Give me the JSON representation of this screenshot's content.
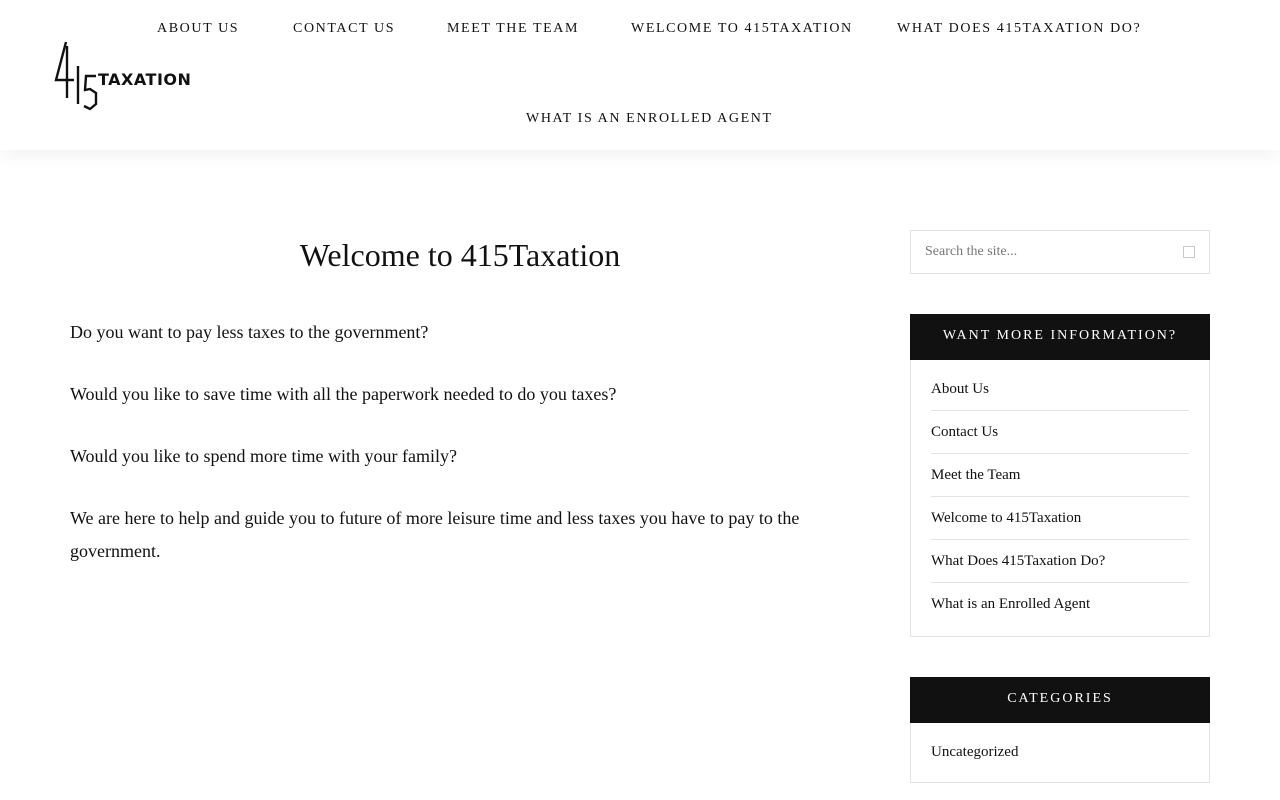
{
  "header": {
    "logo": {
      "mark_text": "415",
      "text": "TAXATION"
    },
    "nav": [
      {
        "label": "About Us"
      },
      {
        "label": "Contact Us"
      },
      {
        "label": "Meet the Team"
      },
      {
        "label": "Welcome to 415Taxation"
      },
      {
        "label": "What Does 415Taxation Do?"
      },
      {
        "label": "What is an Enrolled Agent"
      }
    ]
  },
  "main": {
    "title": "Welcome to 415Taxation",
    "paragraphs": [
      "Do you want to pay less taxes to the government?",
      "Would you like to save time with all the paperwork needed to do you taxes?",
      "Would you like to spend more time with your family?",
      "We are here to help and guide you to future of more leisure time and less taxes you have to pay to the government."
    ]
  },
  "sidebar": {
    "search": {
      "placeholder": "Search the site...",
      "icon": "search-icon"
    },
    "info_widget": {
      "title": "Want More Information?",
      "links": [
        "About Us",
        "Contact Us",
        "Meet the Team",
        "Welcome to 415Taxation",
        "What Does 415Taxation Do?",
        "What is an Enrolled Agent"
      ]
    },
    "categories_widget": {
      "title": "Categories",
      "links": [
        "Uncategorized"
      ]
    }
  },
  "colors": {
    "text": "#111111",
    "widget_header_bg": "#111111",
    "widget_header_text": "#ffffff",
    "border": "#e3e3e3"
  }
}
